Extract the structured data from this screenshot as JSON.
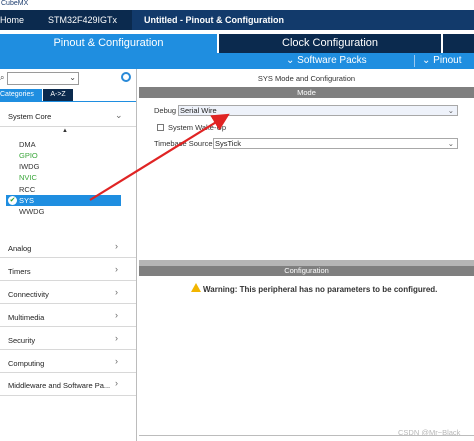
{
  "app": {
    "title": "CubeMX"
  },
  "breadcrumbs": [
    "Home",
    "STM32F429IGTx",
    "Untitled - Pinout & Configuration"
  ],
  "tabs": [
    "Pinout & Configuration",
    "Clock Configuration",
    ""
  ],
  "subbar": {
    "software_packs": "Software Packs",
    "pinout": "Pinout"
  },
  "left_panel": {
    "category_tabs": [
      "Categories",
      "A->Z"
    ],
    "system_core": {
      "label": "System Core",
      "items": [
        {
          "label": "DMA",
          "color": "#333333"
        },
        {
          "label": "GPIO",
          "color": "#3aa63a"
        },
        {
          "label": "IWDG",
          "color": "#333333"
        },
        {
          "label": "NVIC",
          "color": "#3aa63a"
        },
        {
          "label": "RCC",
          "color": "#333333"
        },
        {
          "label": "SYS",
          "color": "#ffffff",
          "selected": true
        },
        {
          "label": "WWDG",
          "color": "#333333"
        }
      ]
    },
    "categories": [
      "Analog",
      "Timers",
      "Connectivity",
      "Multimedia",
      "Security",
      "Computing",
      "Middleware and Software Pa..."
    ]
  },
  "right_panel": {
    "title": "SYS Mode and Configuration",
    "mode_header": "Mode",
    "debug_label": "Debug",
    "debug_value": "Serial Wire",
    "wakeup_label": "System Wake-Up",
    "timebase_label": "Timebase Source",
    "timebase_value": "SysTick",
    "config_header": "Configuration",
    "warning_text": "Warning: This peripheral has no parameters to be configured."
  },
  "watermark": "CSDN @Mr~Black",
  "colors": {
    "accent": "#1f8ee0",
    "dark": "#0b2a4e",
    "warning": "#f2b500",
    "arrow": "#e02424"
  }
}
